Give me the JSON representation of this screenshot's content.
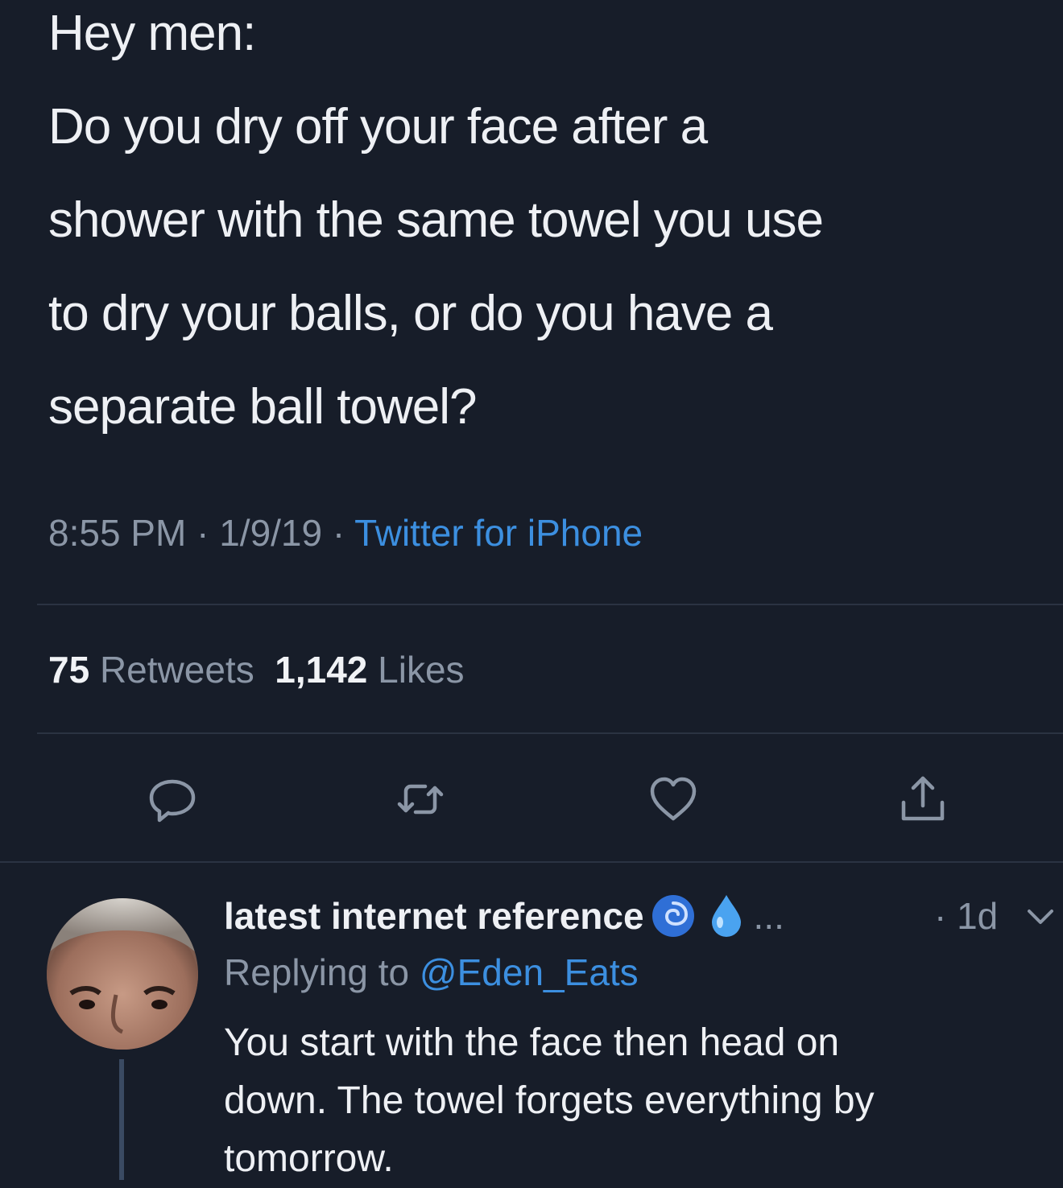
{
  "tweet": {
    "lines": [
      "Hey men:",
      "Do you dry off your face after a",
      "shower with the same towel you use",
      "to dry your balls, or do you have a",
      "separate ball towel?"
    ],
    "time": "8:55 PM",
    "separator": " · ",
    "date": "1/9/19",
    "source": "Twitter for iPhone",
    "retweets_count": "75",
    "retweets_label": "Retweets",
    "likes_count": "1,142",
    "likes_label": "Likes"
  },
  "actions": {
    "reply_icon": "speech-bubble-icon",
    "retweet_icon": "retweet-arrows-icon",
    "like_icon": "heart-icon",
    "share_icon": "share-upload-icon",
    "icon_color": "#8b96a6"
  },
  "reply": {
    "name": "latest internet reference",
    "emoji_1": "cyclone-icon",
    "emoji_2": "droplet-icon",
    "ellipsis": "...",
    "time": "· 1d",
    "replying_prefix": "Replying to",
    "replying_handle": "@Eden_Eats",
    "text_lines": [
      "You start with the face then head on",
      "down. The towel forgets everything by",
      "tomorrow."
    ]
  },
  "colors": {
    "background": "#171d29",
    "link": "#3c8fe0",
    "secondary_text": "#8b96a6",
    "primary_text": "#eef0f4"
  }
}
